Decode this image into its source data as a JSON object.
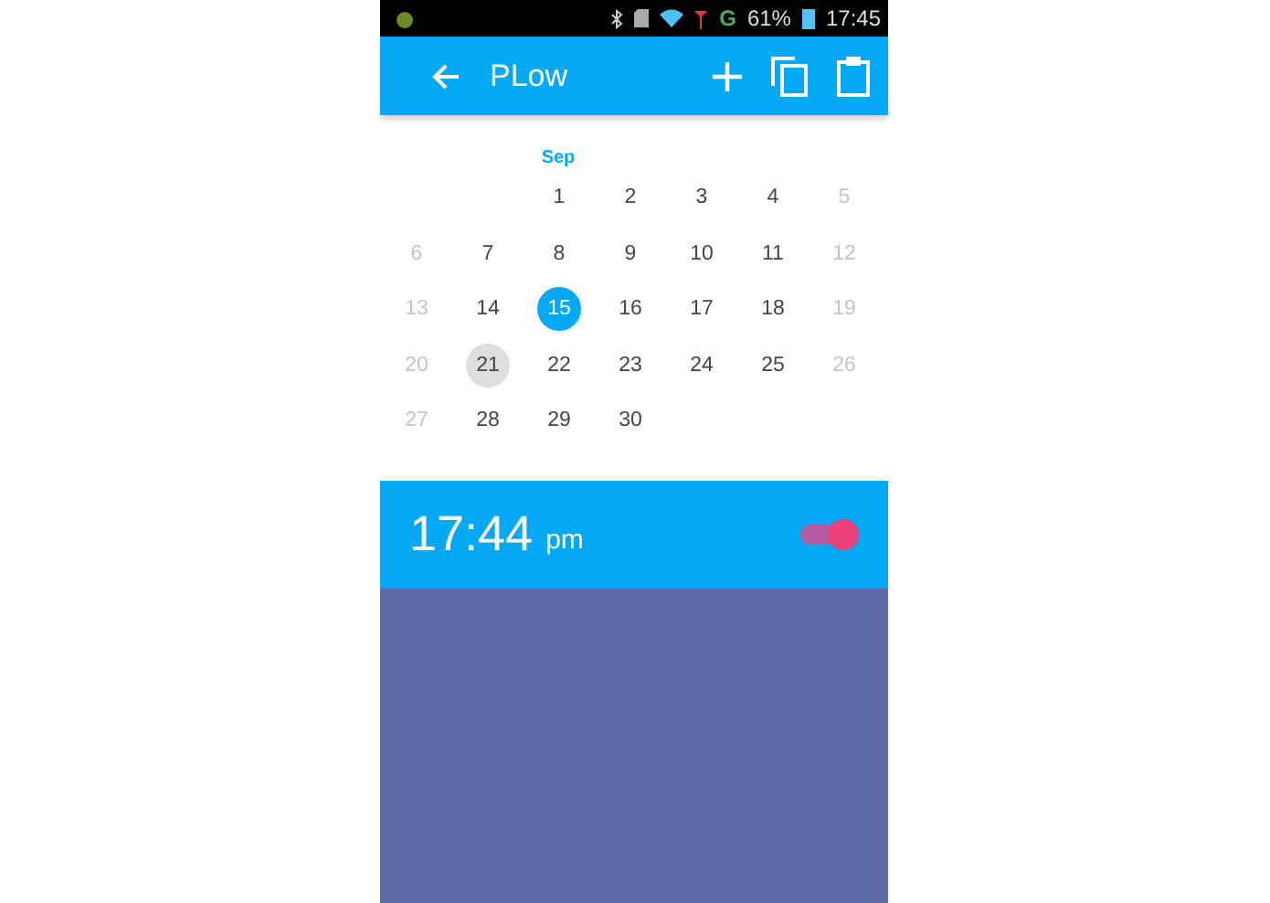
{
  "status_bar": {
    "battery_text": "61%",
    "network": "G",
    "time": "17:45"
  },
  "app_bar": {
    "title": "PLow"
  },
  "calendar": {
    "month": "Sep",
    "weeks": [
      [
        {
          "kind": "blank"
        },
        {
          "kind": "blank"
        },
        {
          "kind": "day",
          "day": "1",
          "muted": false,
          "selected": false,
          "today": false
        },
        {
          "kind": "day",
          "day": "2",
          "muted": false,
          "selected": false,
          "today": false
        },
        {
          "kind": "day",
          "day": "3",
          "muted": false,
          "selected": false,
          "today": false
        },
        {
          "kind": "day",
          "day": "4",
          "muted": false,
          "selected": false,
          "today": false
        },
        {
          "kind": "day",
          "day": "5",
          "muted": true,
          "selected": false,
          "today": false
        }
      ],
      [
        {
          "kind": "day",
          "day": "6",
          "muted": true,
          "selected": false,
          "today": false
        },
        {
          "kind": "day",
          "day": "7",
          "muted": false,
          "selected": false,
          "today": false
        },
        {
          "kind": "day",
          "day": "8",
          "muted": false,
          "selected": false,
          "today": false
        },
        {
          "kind": "day",
          "day": "9",
          "muted": false,
          "selected": false,
          "today": false
        },
        {
          "kind": "day",
          "day": "10",
          "muted": false,
          "selected": false,
          "today": false
        },
        {
          "kind": "day",
          "day": "11",
          "muted": false,
          "selected": false,
          "today": false
        },
        {
          "kind": "day",
          "day": "12",
          "muted": true,
          "selected": false,
          "today": false
        }
      ],
      [
        {
          "kind": "day",
          "day": "13",
          "muted": true,
          "selected": false,
          "today": false
        },
        {
          "kind": "day",
          "day": "14",
          "muted": false,
          "selected": false,
          "today": false
        },
        {
          "kind": "day",
          "day": "15",
          "muted": false,
          "selected": true,
          "today": false
        },
        {
          "kind": "day",
          "day": "16",
          "muted": false,
          "selected": false,
          "today": false
        },
        {
          "kind": "day",
          "day": "17",
          "muted": false,
          "selected": false,
          "today": false
        },
        {
          "kind": "day",
          "day": "18",
          "muted": false,
          "selected": false,
          "today": false
        },
        {
          "kind": "day",
          "day": "19",
          "muted": true,
          "selected": false,
          "today": false
        }
      ],
      [
        {
          "kind": "day",
          "day": "20",
          "muted": true,
          "selected": false,
          "today": false
        },
        {
          "kind": "day",
          "day": "21",
          "muted": false,
          "selected": false,
          "today": true
        },
        {
          "kind": "day",
          "day": "22",
          "muted": false,
          "selected": false,
          "today": false
        },
        {
          "kind": "day",
          "day": "23",
          "muted": false,
          "selected": false,
          "today": false
        },
        {
          "kind": "day",
          "day": "24",
          "muted": false,
          "selected": false,
          "today": false
        },
        {
          "kind": "day",
          "day": "25",
          "muted": false,
          "selected": false,
          "today": false
        },
        {
          "kind": "day",
          "day": "26",
          "muted": true,
          "selected": false,
          "today": false
        }
      ],
      [
        {
          "kind": "day",
          "day": "27",
          "muted": true,
          "selected": false,
          "today": false
        },
        {
          "kind": "day",
          "day": "28",
          "muted": false,
          "selected": false,
          "today": false
        },
        {
          "kind": "day",
          "day": "29",
          "muted": false,
          "selected": false,
          "today": false
        },
        {
          "kind": "day",
          "day": "30",
          "muted": false,
          "selected": false,
          "today": false
        },
        {
          "kind": "blank"
        },
        {
          "kind": "blank"
        },
        {
          "kind": "blank"
        }
      ]
    ]
  },
  "alarm": {
    "time": "17:44",
    "period": "pm",
    "on": true
  }
}
